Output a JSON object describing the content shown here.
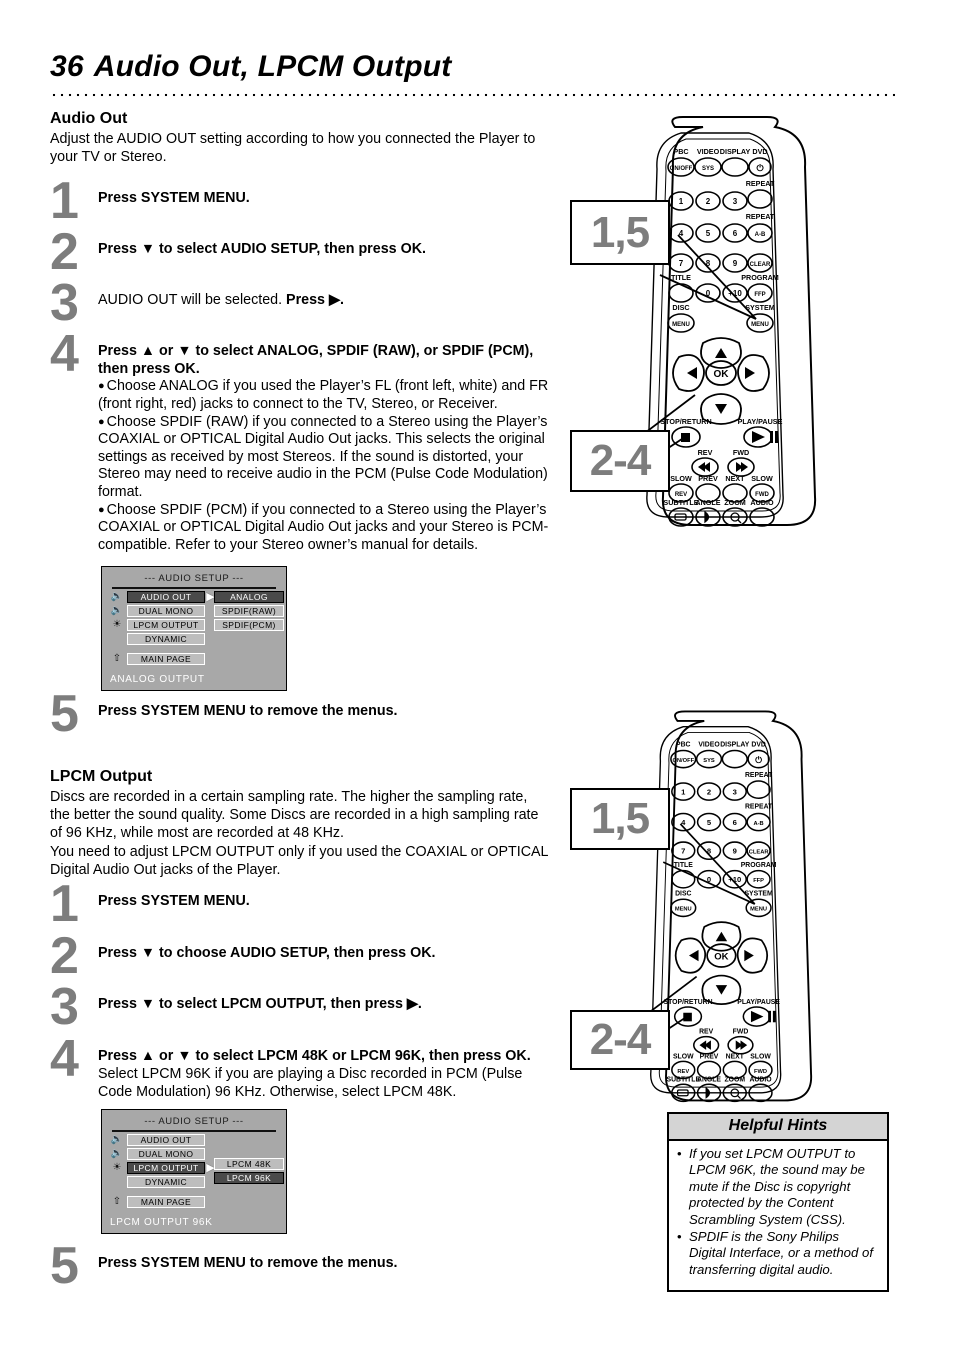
{
  "header": {
    "page_number": "36",
    "title": "Audio Out, LPCM Output"
  },
  "colors": {
    "step_number": "#7d7d7d",
    "osd_background": "#a8a8a8",
    "osd_item": "#bdbdbd",
    "osd_selected": "#4a4a4a",
    "hints_header": "#d4d4d4"
  },
  "section_audio_out": {
    "heading": "Audio Out",
    "intro": "Adjust the AUDIO OUT setting according to how you connected the Player to your TV or Stereo.",
    "steps": [
      {
        "number": "1",
        "text": "Press SYSTEM MENU."
      },
      {
        "number": "2",
        "text": "Press ▼ to select AUDIO SETUP, then press OK."
      },
      {
        "number": "3",
        "text_plain": "AUDIO OUT will be selected. ",
        "text_bold": "Press ▶."
      },
      {
        "number": "4",
        "text": "Press ▲ or ▼ to select ANALOG, SPDIF (RAW), or SPDIF (PCM), then press OK."
      },
      {
        "number": "5",
        "text": "Press SYSTEM MENU to remove the menus."
      }
    ],
    "bullets": [
      "Choose ANALOG if you used the Player’s FL (front left, white) and FR (front right, red) jacks to connect to the TV, Stereo, or Receiver.",
      "Choose SPDIF (RAW) if you connected to a Stereo using the Player’s COAXIAL or OPTICAL Digital Audio Out jacks. This selects the original settings as received by most Stereos. If the sound is distorted, your Stereo may need to receive audio in the PCM (Pulse Code Modulation) format.",
      "Choose SPDIF (PCM) if you connected to a Stereo using the Player’s COAXIAL or OPTICAL Digital Audio Out jacks and your Stereo is PCM-compatible. Refer to your Stereo owner’s manual for details."
    ],
    "osd": {
      "title": "---  AUDIO SETUP  ---",
      "left_items": [
        {
          "label": "AUDIO OUT",
          "icon": "speaker-icon",
          "selected": true,
          "arrow": true
        },
        {
          "label": "DUAL MONO",
          "icon": "speaker-icon",
          "selected": false,
          "arrow": false
        },
        {
          "label": "LPCM OUTPUT",
          "icon": "surround-icon",
          "selected": false,
          "arrow": false
        },
        {
          "label": "DYNAMIC",
          "icon": "",
          "selected": false,
          "arrow": false
        }
      ],
      "right_items": [
        {
          "label": "ANALOG",
          "selected": true
        },
        {
          "label": "SPDIF(RAW)",
          "selected": false
        },
        {
          "label": "SPDIF(PCM)",
          "selected": false
        }
      ],
      "main_page": "MAIN PAGE",
      "main_page_icon": "up-arrow-icon",
      "status": "ANALOG OUTPUT"
    }
  },
  "section_lpcm_output": {
    "heading": "LPCM Output",
    "intro": "Discs are recorded in a certain sampling rate. The higher the sampling rate, the better the sound quality. Some Discs are recorded in a high sampling rate of 96 KHz, while most are recorded at 48 KHz.\nYou need to adjust LPCM OUTPUT only if you used the COAXIAL or OPTICAL Digital Audio Out jacks of the Player.",
    "intro_line1": "Discs are recorded in a certain sampling rate. The higher the sampling rate, the better the sound quality. Some Discs are recorded in a high sampling rate of 96 KHz, while most are recorded at 48 KHz.",
    "intro_line2": "You need to adjust LPCM OUTPUT only if you used the COAXIAL or OPTICAL Digital Audio Out jacks of the Player.",
    "steps": [
      {
        "number": "1",
        "text": "Press SYSTEM MENU."
      },
      {
        "number": "2",
        "text": "Press ▼ to choose AUDIO SETUP, then press OK."
      },
      {
        "number": "3",
        "text": "Press ▼ to select LPCM OUTPUT, then press ▶."
      },
      {
        "number": "4",
        "text_bold": "Press ▲ or ▼ to select LPCM 48K or LPCM 96K, then press OK.",
        "text_plain": " Select LPCM 96K if you are playing a Disc recorded in PCM (Pulse Code Modulation) 96 KHz. Otherwise, select LPCM 48K."
      },
      {
        "number": "5",
        "text": "Press SYSTEM MENU to remove the menus."
      }
    ],
    "osd": {
      "title": "---  AUDIO SETUP  ---",
      "left_items": [
        {
          "label": "AUDIO OUT",
          "icon": "speaker-icon",
          "selected": false,
          "arrow": false
        },
        {
          "label": "DUAL MONO",
          "icon": "speaker-icon",
          "selected": false,
          "arrow": false
        },
        {
          "label": "LPCM OUTPUT",
          "icon": "surround-icon",
          "selected": true,
          "arrow": true
        },
        {
          "label": "DYNAMIC",
          "icon": "",
          "selected": false,
          "arrow": false
        }
      ],
      "right_items": [
        {
          "label": "LPCM 48K",
          "selected": false
        },
        {
          "label": "LPCM 96K",
          "selected": true
        }
      ],
      "main_page": "MAIN PAGE",
      "main_page_icon": "up-arrow-icon",
      "status": "LPCM OUTPUT 96K"
    }
  },
  "remote": {
    "callout_top": "1,5",
    "callout_bottom": "2-4",
    "buttons": [
      {
        "label": "PBC",
        "sub": "ON/OFF"
      },
      {
        "label": "VIDEO",
        "sub": "SYS"
      },
      {
        "label": "DISPLAY",
        "sub": ""
      },
      {
        "label": "DVD",
        "sub": "⏻"
      },
      {
        "label": "",
        "sub": "1"
      },
      {
        "label": "",
        "sub": "2"
      },
      {
        "label": "",
        "sub": "3"
      },
      {
        "label": "REPEAT",
        "sub": ""
      },
      {
        "label": "",
        "sub": "4"
      },
      {
        "label": "",
        "sub": "5"
      },
      {
        "label": "",
        "sub": "6"
      },
      {
        "label": "REPEAT",
        "sub": "A-B"
      },
      {
        "label": "",
        "sub": "7"
      },
      {
        "label": "",
        "sub": "8"
      },
      {
        "label": "",
        "sub": "9"
      },
      {
        "label": "",
        "sub": "CLEAR"
      },
      {
        "label": "TITLE",
        "sub": ""
      },
      {
        "label": "",
        "sub": "0"
      },
      {
        "label": "",
        "sub": "+10"
      },
      {
        "label": "PROGRAM",
        "sub": "FFP"
      },
      {
        "label": "DISC",
        "sub": "MENU"
      },
      {
        "label": "SYSTEM",
        "sub": "MENU"
      },
      {
        "label": "STOP/RETURN",
        "sub": ""
      },
      {
        "label": "PLAY/PAUSE",
        "sub": ""
      },
      {
        "label": "REV",
        "sub": ""
      },
      {
        "label": "FWD",
        "sub": ""
      },
      {
        "label": "SLOW",
        "sub": "REV"
      },
      {
        "label": "PREV",
        "sub": ""
      },
      {
        "label": "NEXT",
        "sub": ""
      },
      {
        "label": "SLOW",
        "sub": "FWD"
      },
      {
        "label": "SUBTITLE",
        "sub": ""
      },
      {
        "label": "ANGLE",
        "sub": ""
      },
      {
        "label": "ZOOM",
        "sub": ""
      },
      {
        "label": "AUDIO",
        "sub": ""
      }
    ],
    "dpad_center": "OK"
  },
  "hints": {
    "title": "Helpful Hints",
    "items": [
      "If you set LPCM OUTPUT to LPCM 96K, the sound may be mute if the Disc is copyright protected by the Content Scrambling System (CSS).",
      "SPDIF is the Sony Philips Digital Interface, or a method of transferring digital audio."
    ]
  }
}
